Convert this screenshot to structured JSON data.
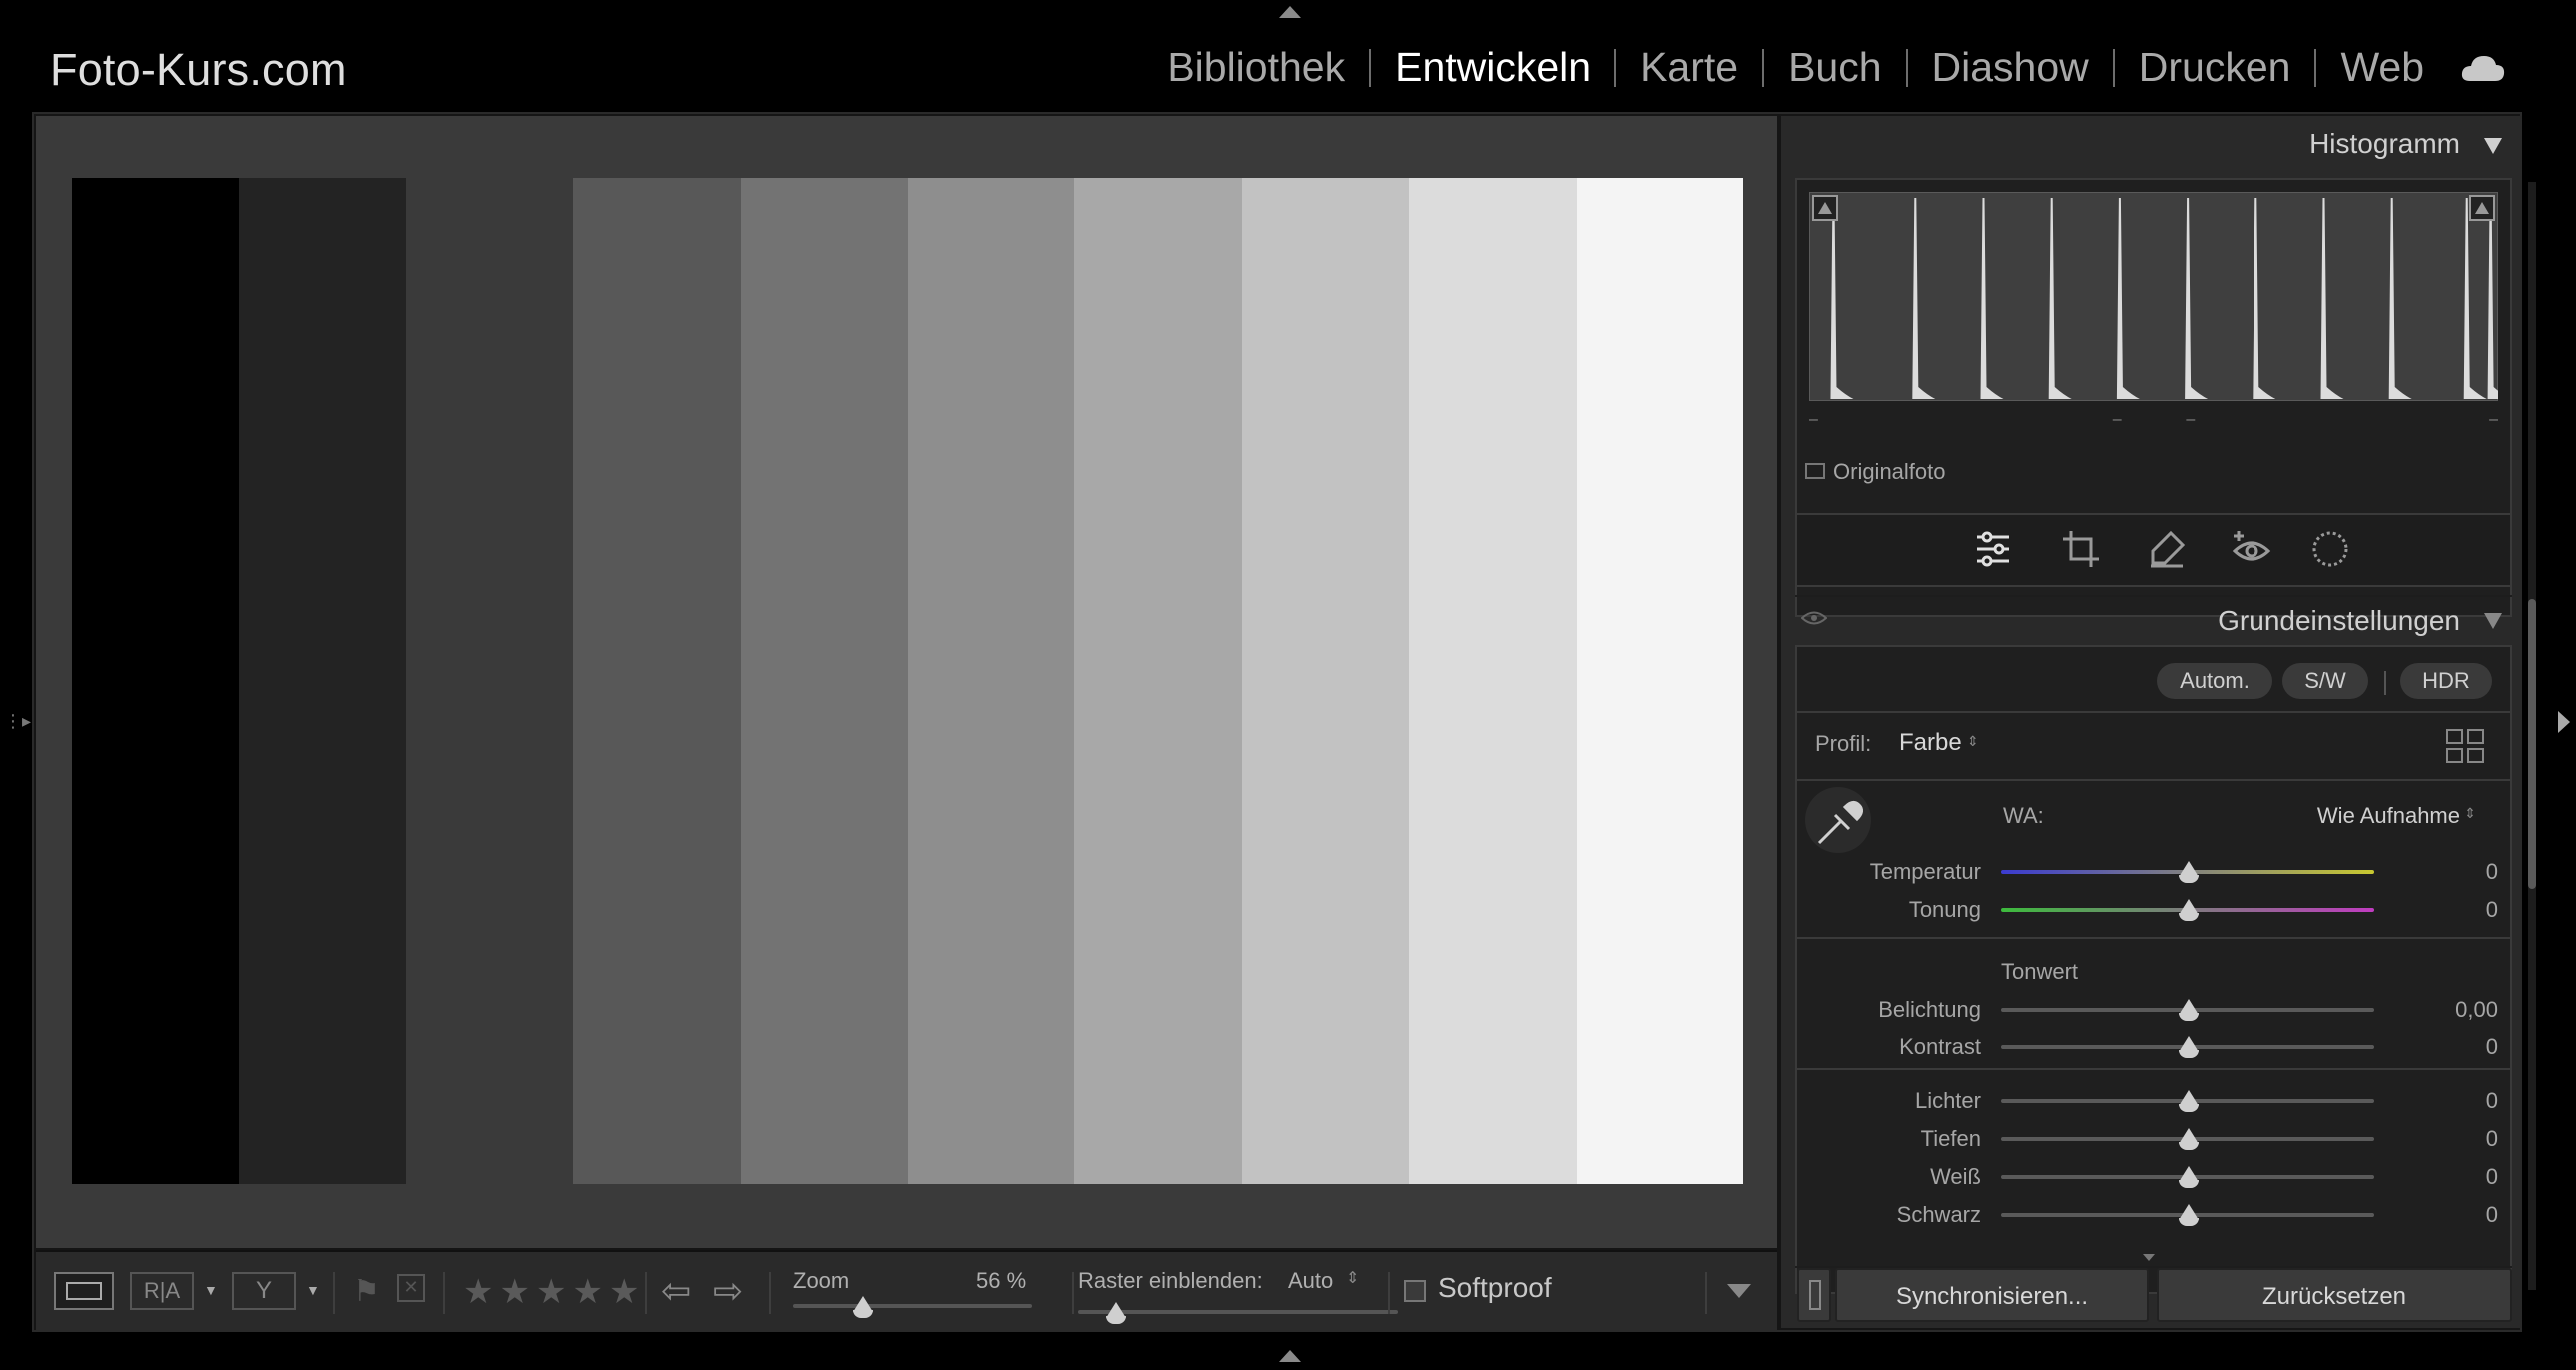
{
  "app": {
    "brand": "Foto-Kurs.com",
    "modules": [
      {
        "label": "Bibliothek",
        "active": false
      },
      {
        "label": "Entwickeln",
        "active": true
      },
      {
        "label": "Karte",
        "active": false
      },
      {
        "label": "Buch",
        "active": false
      },
      {
        "label": "Diashow",
        "active": false
      },
      {
        "label": "Drucken",
        "active": false
      },
      {
        "label": "Web",
        "active": false
      }
    ],
    "cloud_icon": "cloud-icon"
  },
  "image": {
    "strip_colors": [
      "#000000",
      "#232323",
      "#3a3a3a",
      "#585858",
      "#737373",
      "#8e8e8e",
      "#a8a8a8",
      "#c2c2c2",
      "#dcdcdc",
      "#f4f4f4"
    ]
  },
  "toolbar": {
    "zoom_label": "Zoom",
    "zoom_value": "56 %",
    "zoom_fraction": 0.29,
    "grid_label": "Raster einblenden:",
    "grid_value": "Auto",
    "grid_fraction": 0.12,
    "softproof_label": "Softproof",
    "rating_stars": [
      "★",
      "★",
      "★",
      "★",
      "★"
    ]
  },
  "histogram": {
    "title": "Histogramm",
    "original_label": "Originalfoto",
    "peak_positions": [
      0.03,
      0.15,
      0.25,
      0.35,
      0.45,
      0.55,
      0.65,
      0.75,
      0.85,
      0.96,
      0.995
    ],
    "tick_marks": [
      "–",
      "–",
      "–",
      "–"
    ]
  },
  "basic": {
    "title": "Grundeinstellungen",
    "auto_label": "Autom.",
    "bw_label": "S/W",
    "hdr_label": "HDR",
    "profile_label": "Profil:",
    "profile_value": "Farbe",
    "wb_label": "WA:",
    "wb_value": "Wie Aufnahme",
    "tone_label": "Tonwert",
    "temp_label": "Temperatur",
    "temp_value": "0",
    "tint_label": "Tonung",
    "tint_value": "0",
    "sliders": [
      {
        "label": "Belichtung",
        "value": "0,00"
      },
      {
        "label": "Kontrast",
        "value": "0"
      },
      {
        "label": "Lichter",
        "value": "0"
      },
      {
        "label": "Tiefen",
        "value": "0"
      },
      {
        "label": "Weiß",
        "value": "0"
      },
      {
        "label": "Schwarz",
        "value": "0"
      }
    ]
  },
  "footer": {
    "sync_label": "Synchronisieren...",
    "reset_label": "Zurücksetzen"
  }
}
